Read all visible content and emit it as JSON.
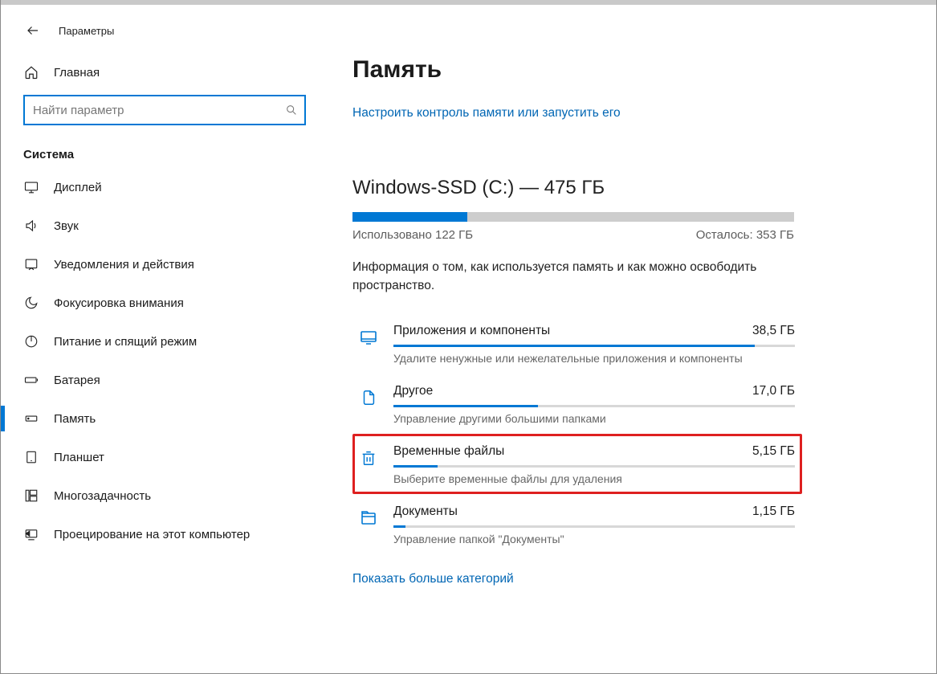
{
  "header": {
    "app_title": "Параметры"
  },
  "sidebar": {
    "home_label": "Главная",
    "search_placeholder": "Найти параметр",
    "group_title": "Система",
    "items": [
      {
        "key": "display",
        "label": "Дисплей"
      },
      {
        "key": "sound",
        "label": "Звук"
      },
      {
        "key": "notifications",
        "label": "Уведомления и действия"
      },
      {
        "key": "focus",
        "label": "Фокусировка внимания"
      },
      {
        "key": "power",
        "label": "Питание и спящий режим"
      },
      {
        "key": "battery",
        "label": "Батарея"
      },
      {
        "key": "storage",
        "label": "Память"
      },
      {
        "key": "tablet",
        "label": "Планшет"
      },
      {
        "key": "multitask",
        "label": "Многозадачность"
      },
      {
        "key": "project",
        "label": "Проецирование на этот компьютер"
      }
    ],
    "active_key": "storage"
  },
  "main": {
    "title": "Память",
    "configure_link": "Настроить контроль памяти или запустить его",
    "drive": {
      "title": "Windows-SSD (C:) — 475 ГБ",
      "used_label": "Использовано 122 ГБ",
      "remaining_label": "Осталось: 353 ГБ",
      "used_pct": 26
    },
    "description": "Информация о том, как используется память и как можно освободить пространство.",
    "categories": [
      {
        "icon": "apps",
        "label": "Приложения и компоненты",
        "value": "38,5 ГБ",
        "fill_pct": 90,
        "hint": "Удалите ненужные или нежелательные приложения и компоненты",
        "highlight": false
      },
      {
        "icon": "folder",
        "label": "Другое",
        "value": "17,0 ГБ",
        "fill_pct": 36,
        "hint": "Управление другими большими папками",
        "highlight": false
      },
      {
        "icon": "trash",
        "label": "Временные файлы",
        "value": "5,15 ГБ",
        "fill_pct": 11,
        "hint": "Выберите временные файлы для удаления",
        "highlight": true
      },
      {
        "icon": "docs",
        "label": "Документы",
        "value": "1,15 ГБ",
        "fill_pct": 3,
        "hint": "Управление папкой \"Документы\"",
        "highlight": false
      }
    ],
    "more_link": "Показать больше категорий"
  }
}
